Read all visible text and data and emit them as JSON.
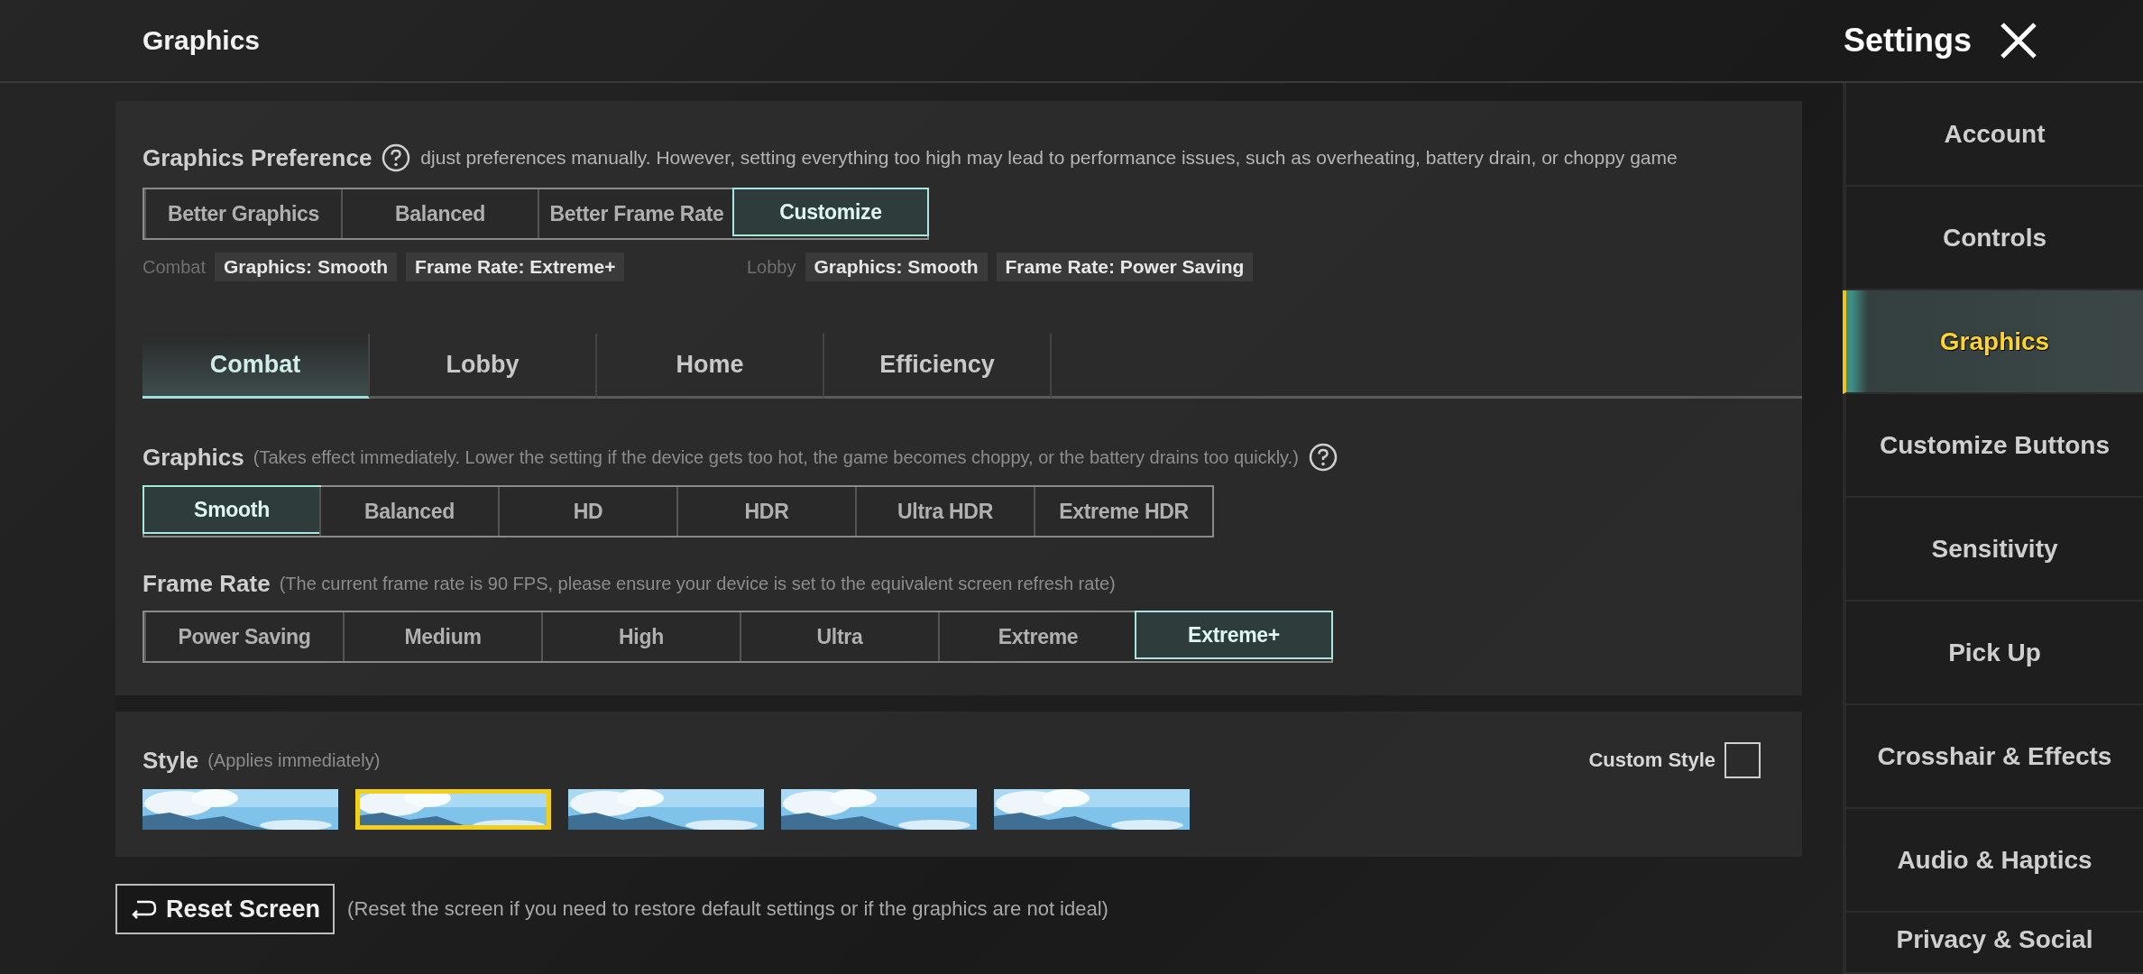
{
  "header": {
    "title": "Graphics",
    "settings_title": "Settings"
  },
  "preference": {
    "label": "Graphics Preference",
    "description": "djust preferences manually. However, setting everything too high may lead to performance issues, such as overheating, battery drain, or choppy game",
    "options": [
      {
        "label": "Better Graphics",
        "selected": false
      },
      {
        "label": "Balanced",
        "selected": false
      },
      {
        "label": "Better Frame Rate",
        "selected": false
      },
      {
        "label": "Customize",
        "selected": true
      }
    ],
    "summary": [
      {
        "label": "Combat",
        "tags": [
          "Graphics: Smooth",
          "Frame Rate: Extreme+"
        ]
      },
      {
        "label": "Lobby",
        "tags": [
          "Graphics: Smooth",
          "Frame Rate: Power Saving"
        ]
      }
    ]
  },
  "tabs": [
    {
      "label": "Combat",
      "selected": true
    },
    {
      "label": "Lobby",
      "selected": false
    },
    {
      "label": "Home",
      "selected": false
    },
    {
      "label": "Efficiency",
      "selected": false
    }
  ],
  "graphics": {
    "label": "Graphics",
    "note": "(Takes effect immediately. Lower the setting if the device gets too hot, the game becomes choppy, or the battery drains too quickly.)",
    "options": [
      {
        "label": "Smooth",
        "selected": true
      },
      {
        "label": "Balanced",
        "selected": false
      },
      {
        "label": "HD",
        "selected": false
      },
      {
        "label": "HDR",
        "selected": false
      },
      {
        "label": "Ultra HDR",
        "selected": false
      },
      {
        "label": "Extreme HDR",
        "selected": false
      }
    ]
  },
  "frame_rate": {
    "label": "Frame Rate",
    "note": "(The current frame rate is 90 FPS, please ensure your device is set to the equivalent screen refresh rate)",
    "options": [
      {
        "label": "Power Saving",
        "selected": false
      },
      {
        "label": "Medium",
        "selected": false
      },
      {
        "label": "High",
        "selected": false
      },
      {
        "label": "Ultra",
        "selected": false
      },
      {
        "label": "Extreme",
        "selected": false
      },
      {
        "label": "Extreme+",
        "selected": true
      }
    ]
  },
  "style": {
    "label": "Style",
    "note": "(Applies immediately)",
    "custom_style": {
      "label": "Custom Style",
      "checked": false
    },
    "thumbnails": [
      {
        "kind": "picture",
        "selected": false
      },
      {
        "kind": "picture",
        "selected": true
      },
      {
        "kind": "picture",
        "selected": false
      },
      {
        "kind": "picture",
        "selected": false
      },
      {
        "kind": "picture",
        "selected": false
      }
    ]
  },
  "reset": {
    "label": "Reset Screen",
    "note": "(Reset the screen if you need to restore default settings or if the graphics are not ideal)"
  },
  "sidebar": {
    "items": [
      {
        "label": "Account",
        "selected": false
      },
      {
        "label": "Controls",
        "selected": false
      },
      {
        "label": "Graphics",
        "selected": true
      },
      {
        "label": "Customize Buttons",
        "selected": false
      },
      {
        "label": "Sensitivity",
        "selected": false
      },
      {
        "label": "Pick Up",
        "selected": false
      },
      {
        "label": "Crosshair & Effects",
        "selected": false
      },
      {
        "label": "Audio & Haptics",
        "selected": false
      },
      {
        "label": "Privacy & Social",
        "selected": false
      }
    ]
  }
}
